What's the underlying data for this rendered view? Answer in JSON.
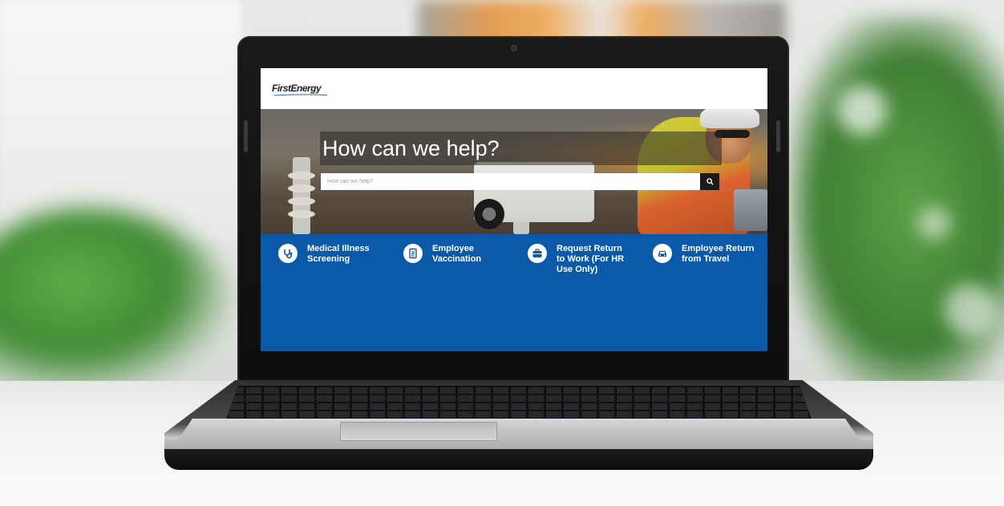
{
  "site": {
    "logo_text": "FirstEnergy",
    "hero": {
      "title": "How can we help?",
      "search_placeholder": "How can we help?"
    },
    "quick_links": [
      {
        "label": "Medical Illness Screening",
        "icon": "stethoscope-icon"
      },
      {
        "label": "Employee Vaccination",
        "icon": "document-icon"
      },
      {
        "label": "Request Return to Work (For HR Use Only)",
        "icon": "briefcase-icon"
      },
      {
        "label": "Employee Return from Travel",
        "icon": "car-icon"
      }
    ]
  },
  "colors": {
    "brand_blue": "#0b5aa9",
    "search_button": "#1b1b1b",
    "hero_overlay": "#282828"
  }
}
